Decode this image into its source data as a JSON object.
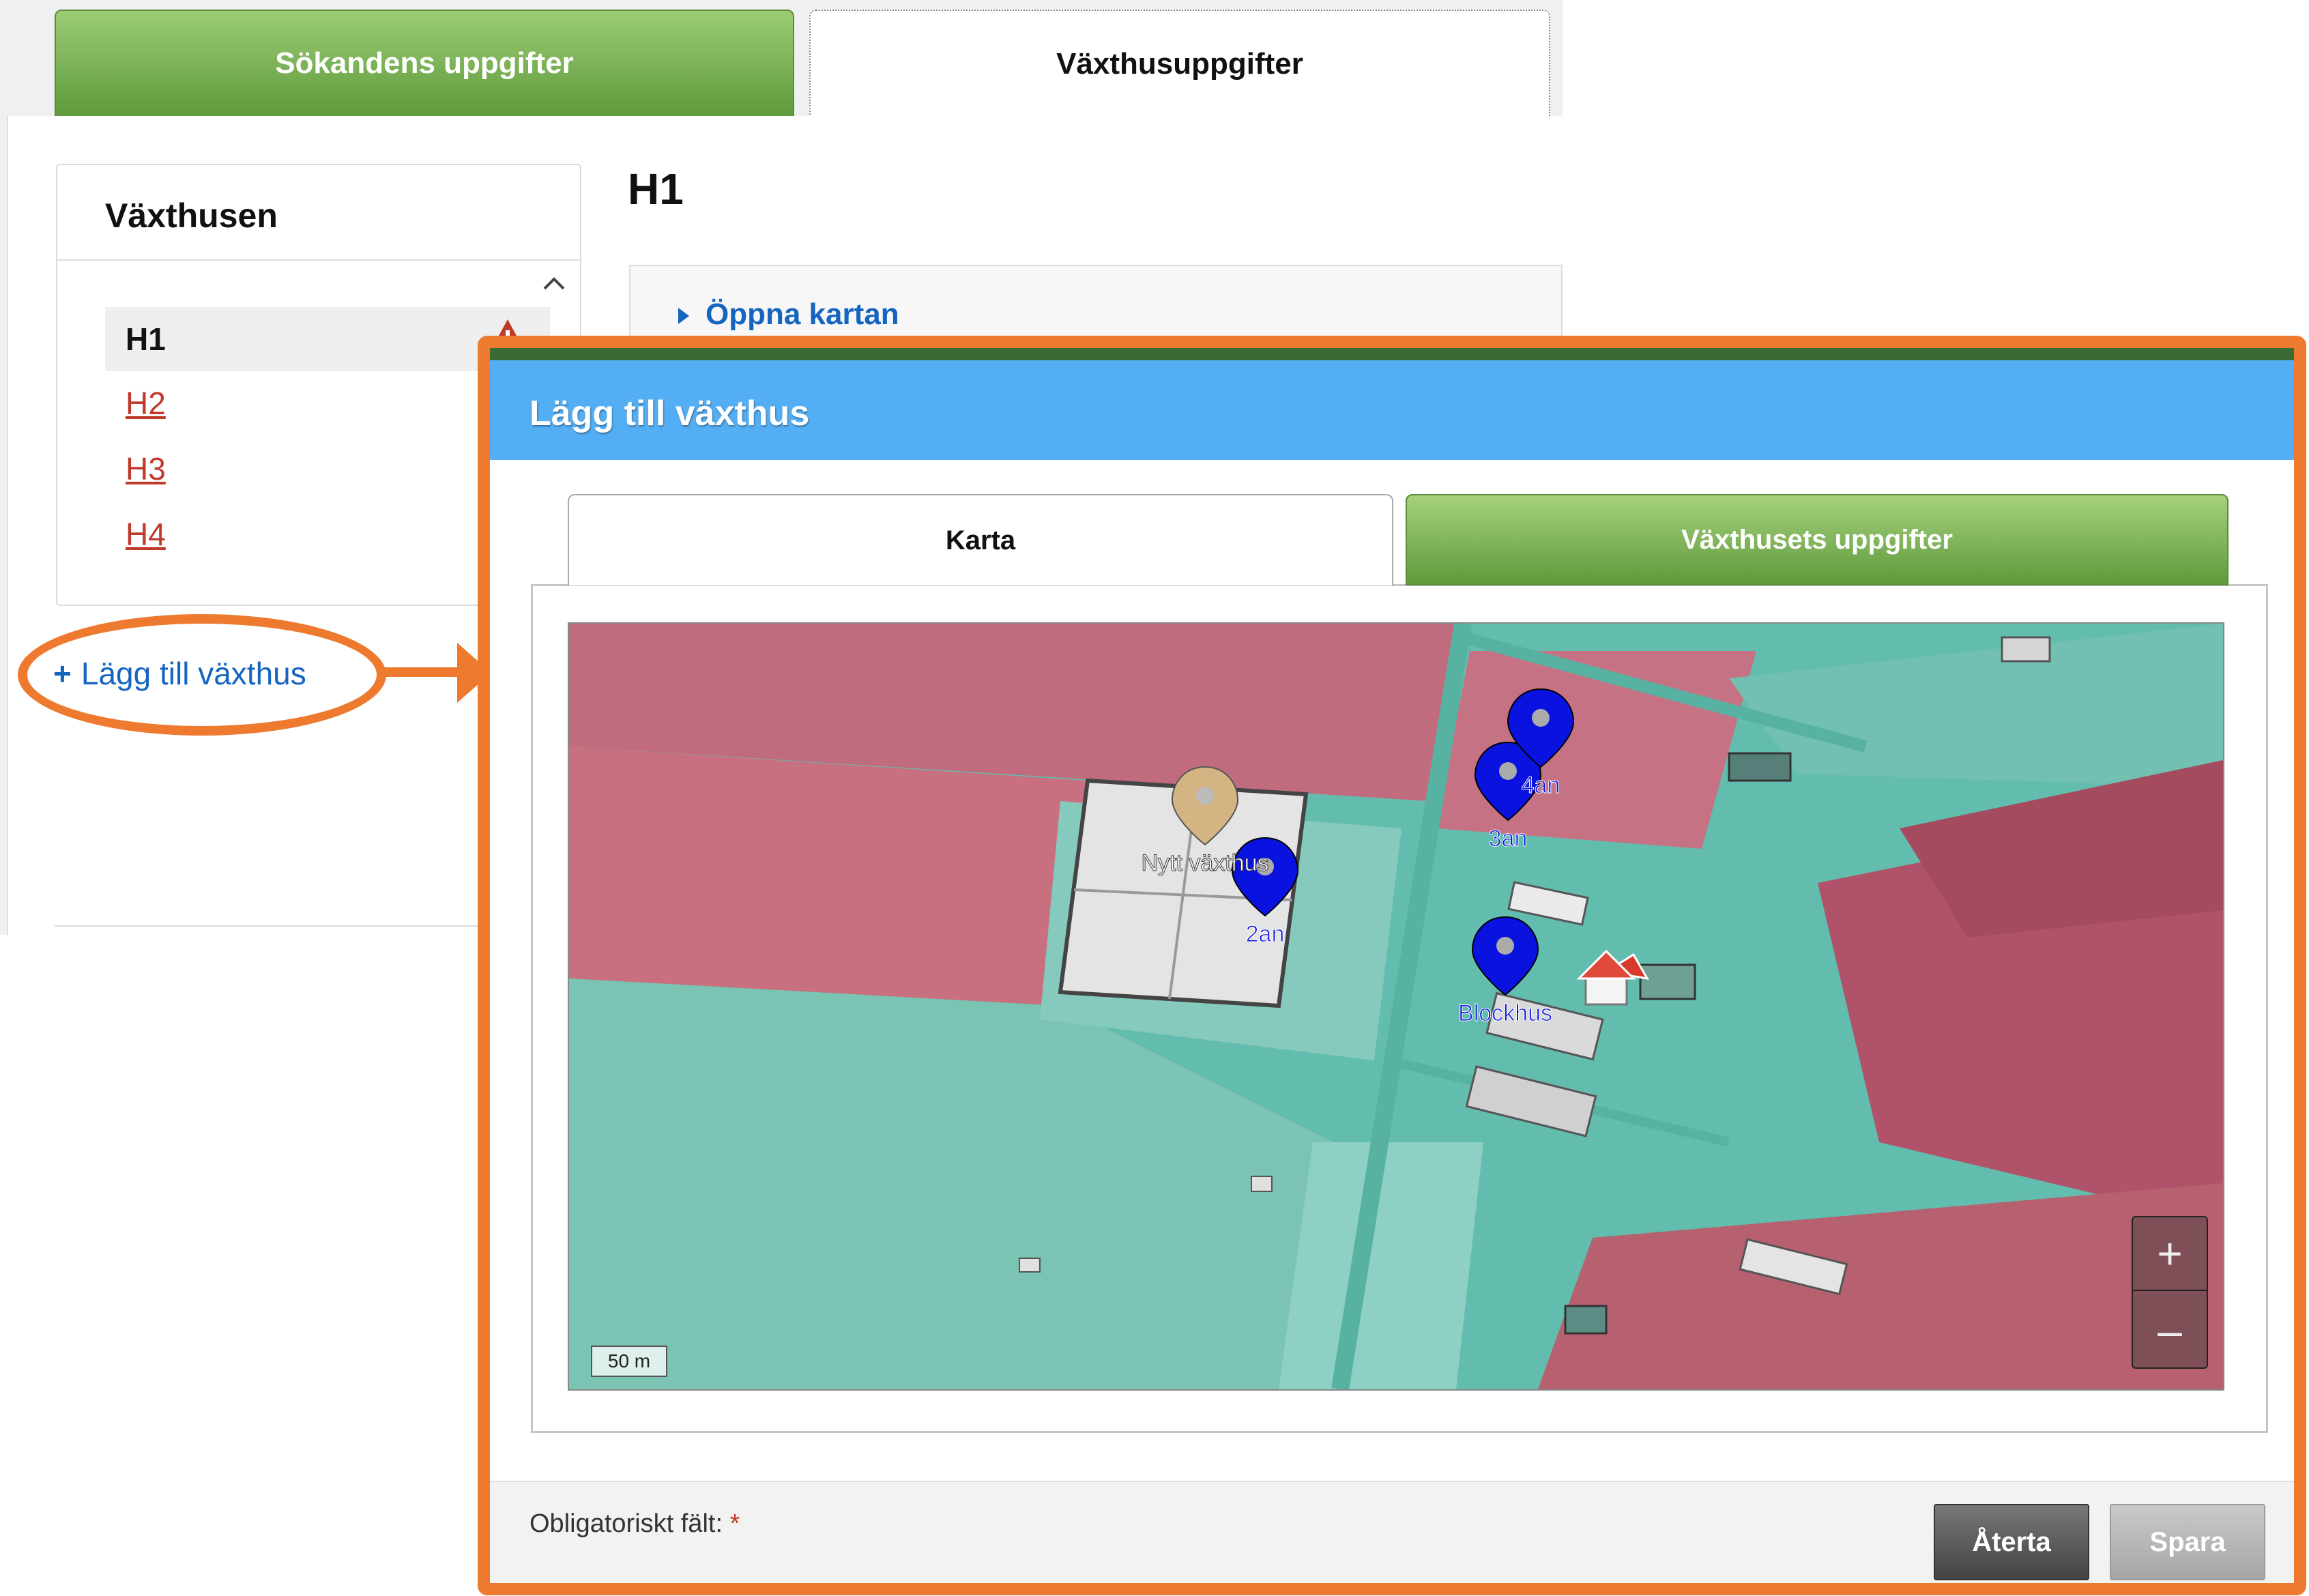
{
  "background_app": {
    "tabs": [
      {
        "label": "Sökandens uppgifter",
        "active": false
      },
      {
        "label": "Växthusuppgifter",
        "active": true
      }
    ],
    "list": {
      "title": "Växthusen",
      "items": [
        {
          "label": "H1",
          "selected": true,
          "warning": true
        },
        {
          "label": "H2",
          "selected": false,
          "warning": true
        },
        {
          "label": "H3",
          "selected": false,
          "warning": true
        },
        {
          "label": "H4",
          "selected": false,
          "warning": true
        }
      ],
      "scroll_icon": "chevron-up-icon",
      "warning_icon": "warning-icon"
    },
    "add_link": {
      "plus": "+",
      "label": "Lägg till växthus"
    },
    "detail": {
      "title": "H1",
      "open_map": "Öppna kartan"
    }
  },
  "modal": {
    "title": "Lägg till växthus",
    "tabs": [
      {
        "label": "Karta",
        "active": true
      },
      {
        "label": "Växthusets uppgifter",
        "active": false
      }
    ],
    "map": {
      "zoom_in": "+",
      "zoom_out": "–",
      "scale": "50 m",
      "markers": [
        {
          "label": "Blockhus",
          "color": "#0a12e0"
        },
        {
          "label": "Nytt växthus",
          "color": "#d4b483"
        },
        {
          "label": "2an",
          "color": "#0a12e0"
        },
        {
          "label": "3an",
          "color": "#0a12e0"
        },
        {
          "label": "4an",
          "color": "#0a12e0"
        }
      ]
    },
    "footer": {
      "required_label": "Obligatoriskt fält:",
      "required_star": "*",
      "cancel": "Återta",
      "save": "Spara"
    }
  },
  "colors": {
    "accent_orange": "#ee7a2f",
    "modal_header": "#54aef3",
    "tab_green": "#6aa544",
    "link_blue": "#1565c0",
    "warning_red": "#c0392b"
  }
}
